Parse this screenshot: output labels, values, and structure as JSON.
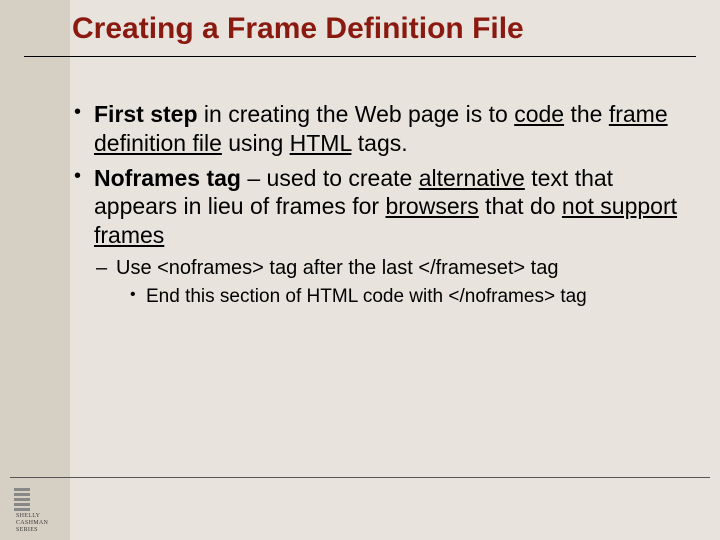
{
  "title": "Creating a Frame Definition File",
  "bullets": {
    "item1": {
      "pre_bold": "First step",
      "mid1": " in creating the Web page is to ",
      "u1": "code",
      "mid2": " the ",
      "u2": "frame definition file",
      "mid3": " using ",
      "u3": "HTML",
      "tail": " tags."
    },
    "item2": {
      "pre_bold": "Noframes tag",
      "mid1": " – used to create ",
      "u1": "alternative",
      "mid2": " text that appears in lieu of frames for ",
      "u2": "browsers",
      "mid3": " that do ",
      "u3": "not support frames"
    },
    "sub1": "Use <noframes> tag after the last </frameset> tag",
    "subsub1": "End this section of HTML code with </noframes> tag"
  },
  "logo": {
    "line1": "SHELLY",
    "line2": "CASHMAN",
    "line3": "SERIES"
  }
}
